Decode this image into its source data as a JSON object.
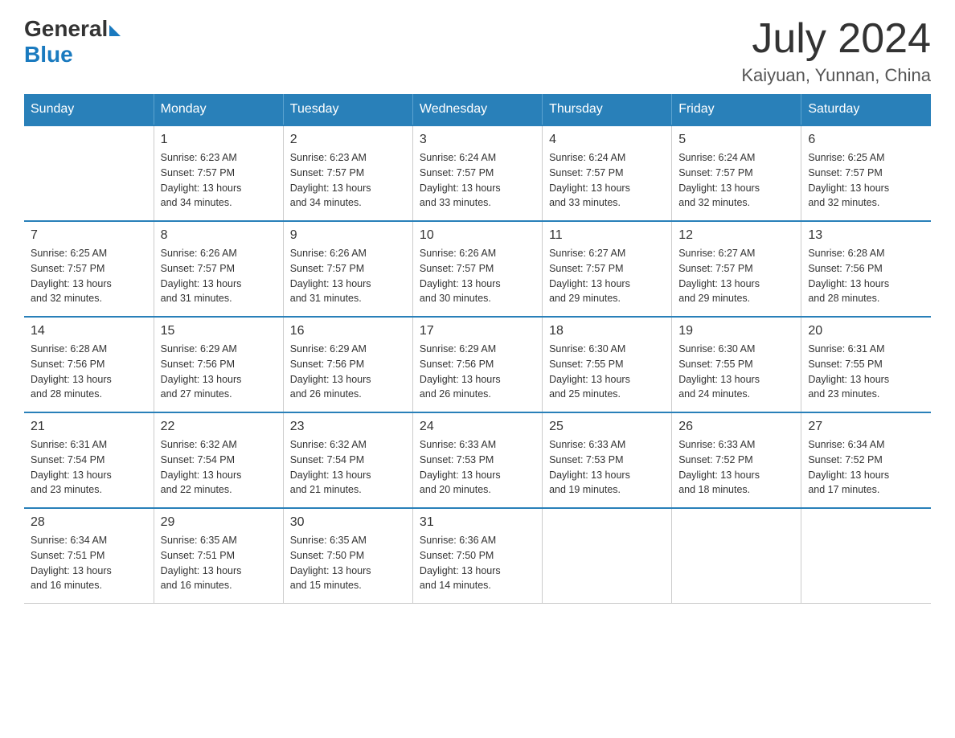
{
  "logo": {
    "general": "General",
    "blue": "Blue"
  },
  "header": {
    "month_year": "July 2024",
    "location": "Kaiyuan, Yunnan, China"
  },
  "days_of_week": [
    "Sunday",
    "Monday",
    "Tuesday",
    "Wednesday",
    "Thursday",
    "Friday",
    "Saturday"
  ],
  "weeks": [
    [
      {
        "day": "",
        "info": ""
      },
      {
        "day": "1",
        "info": "Sunrise: 6:23 AM\nSunset: 7:57 PM\nDaylight: 13 hours\nand 34 minutes."
      },
      {
        "day": "2",
        "info": "Sunrise: 6:23 AM\nSunset: 7:57 PM\nDaylight: 13 hours\nand 34 minutes."
      },
      {
        "day": "3",
        "info": "Sunrise: 6:24 AM\nSunset: 7:57 PM\nDaylight: 13 hours\nand 33 minutes."
      },
      {
        "day": "4",
        "info": "Sunrise: 6:24 AM\nSunset: 7:57 PM\nDaylight: 13 hours\nand 33 minutes."
      },
      {
        "day": "5",
        "info": "Sunrise: 6:24 AM\nSunset: 7:57 PM\nDaylight: 13 hours\nand 32 minutes."
      },
      {
        "day": "6",
        "info": "Sunrise: 6:25 AM\nSunset: 7:57 PM\nDaylight: 13 hours\nand 32 minutes."
      }
    ],
    [
      {
        "day": "7",
        "info": "Sunrise: 6:25 AM\nSunset: 7:57 PM\nDaylight: 13 hours\nand 32 minutes."
      },
      {
        "day": "8",
        "info": "Sunrise: 6:26 AM\nSunset: 7:57 PM\nDaylight: 13 hours\nand 31 minutes."
      },
      {
        "day": "9",
        "info": "Sunrise: 6:26 AM\nSunset: 7:57 PM\nDaylight: 13 hours\nand 31 minutes."
      },
      {
        "day": "10",
        "info": "Sunrise: 6:26 AM\nSunset: 7:57 PM\nDaylight: 13 hours\nand 30 minutes."
      },
      {
        "day": "11",
        "info": "Sunrise: 6:27 AM\nSunset: 7:57 PM\nDaylight: 13 hours\nand 29 minutes."
      },
      {
        "day": "12",
        "info": "Sunrise: 6:27 AM\nSunset: 7:57 PM\nDaylight: 13 hours\nand 29 minutes."
      },
      {
        "day": "13",
        "info": "Sunrise: 6:28 AM\nSunset: 7:56 PM\nDaylight: 13 hours\nand 28 minutes."
      }
    ],
    [
      {
        "day": "14",
        "info": "Sunrise: 6:28 AM\nSunset: 7:56 PM\nDaylight: 13 hours\nand 28 minutes."
      },
      {
        "day": "15",
        "info": "Sunrise: 6:29 AM\nSunset: 7:56 PM\nDaylight: 13 hours\nand 27 minutes."
      },
      {
        "day": "16",
        "info": "Sunrise: 6:29 AM\nSunset: 7:56 PM\nDaylight: 13 hours\nand 26 minutes."
      },
      {
        "day": "17",
        "info": "Sunrise: 6:29 AM\nSunset: 7:56 PM\nDaylight: 13 hours\nand 26 minutes."
      },
      {
        "day": "18",
        "info": "Sunrise: 6:30 AM\nSunset: 7:55 PM\nDaylight: 13 hours\nand 25 minutes."
      },
      {
        "day": "19",
        "info": "Sunrise: 6:30 AM\nSunset: 7:55 PM\nDaylight: 13 hours\nand 24 minutes."
      },
      {
        "day": "20",
        "info": "Sunrise: 6:31 AM\nSunset: 7:55 PM\nDaylight: 13 hours\nand 23 minutes."
      }
    ],
    [
      {
        "day": "21",
        "info": "Sunrise: 6:31 AM\nSunset: 7:54 PM\nDaylight: 13 hours\nand 23 minutes."
      },
      {
        "day": "22",
        "info": "Sunrise: 6:32 AM\nSunset: 7:54 PM\nDaylight: 13 hours\nand 22 minutes."
      },
      {
        "day": "23",
        "info": "Sunrise: 6:32 AM\nSunset: 7:54 PM\nDaylight: 13 hours\nand 21 minutes."
      },
      {
        "day": "24",
        "info": "Sunrise: 6:33 AM\nSunset: 7:53 PM\nDaylight: 13 hours\nand 20 minutes."
      },
      {
        "day": "25",
        "info": "Sunrise: 6:33 AM\nSunset: 7:53 PM\nDaylight: 13 hours\nand 19 minutes."
      },
      {
        "day": "26",
        "info": "Sunrise: 6:33 AM\nSunset: 7:52 PM\nDaylight: 13 hours\nand 18 minutes."
      },
      {
        "day": "27",
        "info": "Sunrise: 6:34 AM\nSunset: 7:52 PM\nDaylight: 13 hours\nand 17 minutes."
      }
    ],
    [
      {
        "day": "28",
        "info": "Sunrise: 6:34 AM\nSunset: 7:51 PM\nDaylight: 13 hours\nand 16 minutes."
      },
      {
        "day": "29",
        "info": "Sunrise: 6:35 AM\nSunset: 7:51 PM\nDaylight: 13 hours\nand 16 minutes."
      },
      {
        "day": "30",
        "info": "Sunrise: 6:35 AM\nSunset: 7:50 PM\nDaylight: 13 hours\nand 15 minutes."
      },
      {
        "day": "31",
        "info": "Sunrise: 6:36 AM\nSunset: 7:50 PM\nDaylight: 13 hours\nand 14 minutes."
      },
      {
        "day": "",
        "info": ""
      },
      {
        "day": "",
        "info": ""
      },
      {
        "day": "",
        "info": ""
      }
    ]
  ]
}
